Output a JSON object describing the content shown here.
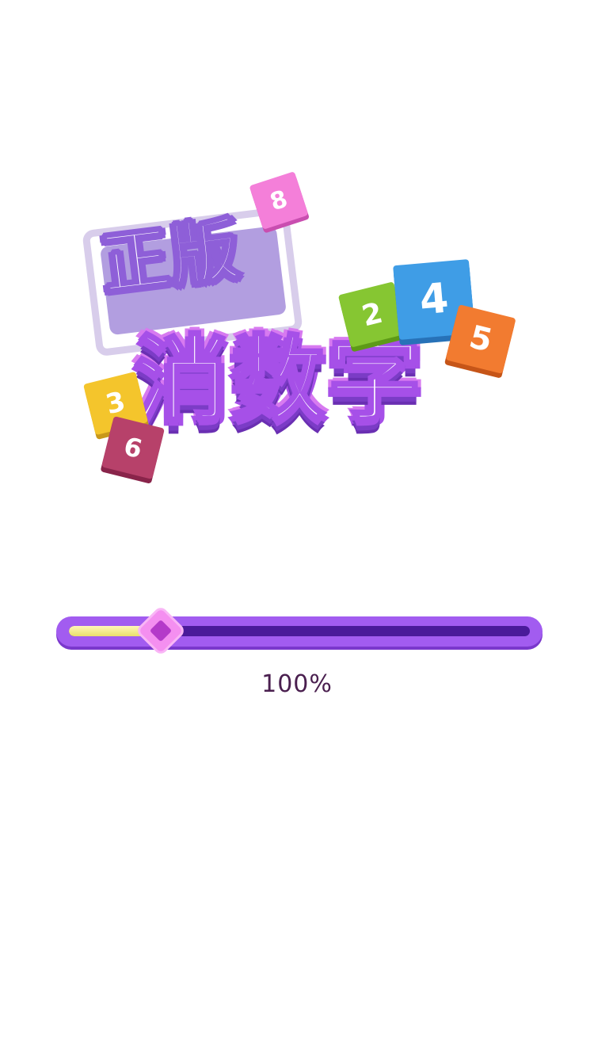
{
  "logo": {
    "title_top": "正版",
    "title_main": "消数字",
    "tiles": [
      {
        "label": "8",
        "color": "#f47fd9"
      },
      {
        "label": "2",
        "color": "#86c632"
      },
      {
        "label": "4",
        "color": "#3f9de6"
      },
      {
        "label": "5",
        "color": "#f27b30"
      },
      {
        "label": "3",
        "color": "#f4c52c"
      },
      {
        "label": "6",
        "color": "#b7416a"
      }
    ]
  },
  "loading": {
    "progress_fraction": 0.2,
    "label": "100%",
    "bar_color": "#a25cf0",
    "track_color": "#4a1a9a",
    "fill_color": "#fff7b8",
    "knob_color": "#f48ff0"
  }
}
